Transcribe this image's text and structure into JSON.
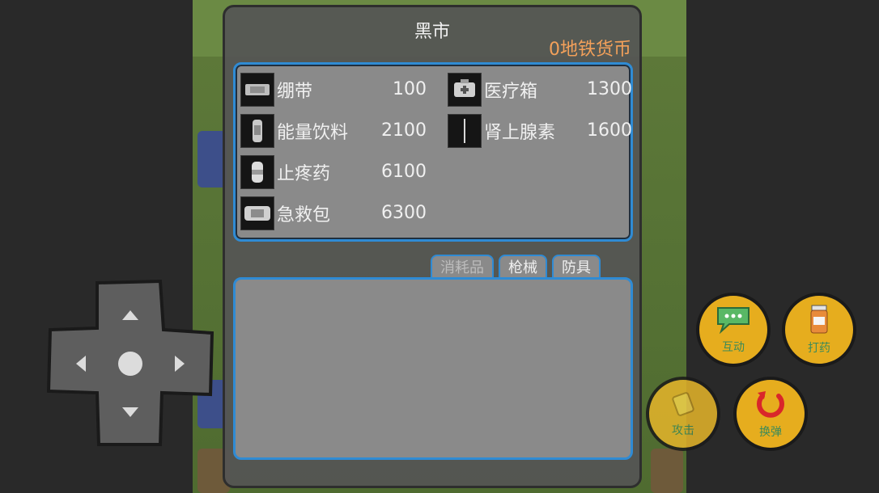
{
  "shop": {
    "title": "黑市",
    "currency": "0地铁货币"
  },
  "items": [
    {
      "name": "绷带",
      "price": "100",
      "icon": "bandage-icon"
    },
    {
      "name": "医疗箱",
      "price": "1300",
      "icon": "medkit-icon"
    },
    {
      "name": "能量饮料",
      "price": "2100",
      "icon": "energy-drink-icon"
    },
    {
      "name": "肾上腺素",
      "price": "1600",
      "icon": "adrenaline-icon"
    },
    {
      "name": "止疼药",
      "price": "6100",
      "icon": "painkiller-icon"
    },
    {
      "name": "急救包",
      "price": "6300",
      "icon": "first-aid-kit-icon"
    }
  ],
  "tabs": [
    {
      "label": "消耗品"
    },
    {
      "label": "枪械"
    },
    {
      "label": "防具"
    }
  ],
  "actions": {
    "interact": "互动",
    "heal": "打药",
    "attack": "攻击",
    "reload": "换弹"
  },
  "colors": {
    "currency": "#f3a05a",
    "panel_border": "#2f8bd4",
    "action_button": "#e6ad1e"
  }
}
